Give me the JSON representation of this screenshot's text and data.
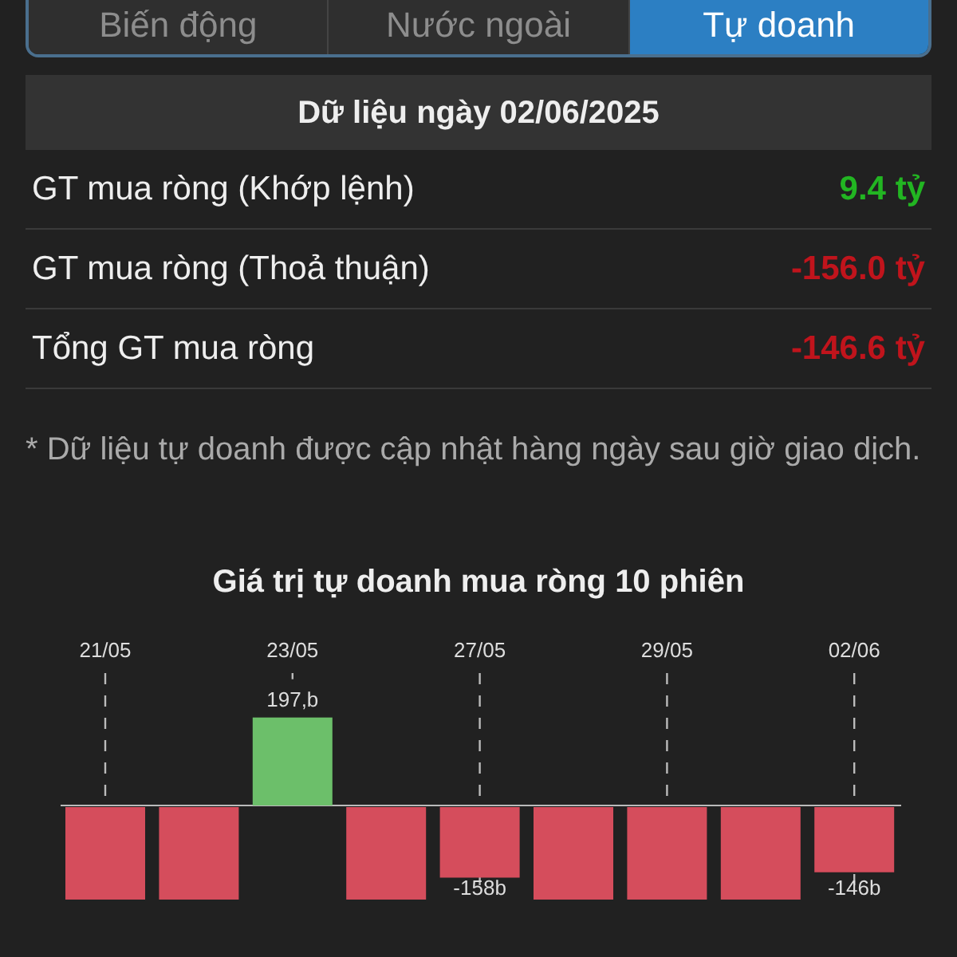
{
  "tabs": [
    {
      "label": "Biến động",
      "selected": false
    },
    {
      "label": "Nước ngoài",
      "selected": false
    },
    {
      "label": "Tự doanh",
      "selected": true
    }
  ],
  "header": "Dữ liệu ngày 02/06/2025",
  "rows": [
    {
      "label": "GT mua ròng (Khớp lệnh)",
      "value": "9.4 tỷ",
      "kind": "gain"
    },
    {
      "label": "GT mua ròng (Thoả thuận)",
      "value": "-156.0 tỷ",
      "kind": "loss"
    },
    {
      "label": "Tổng GT mua ròng",
      "value": "-146.6 tỷ",
      "kind": "loss"
    }
  ],
  "note": "* Dữ liệu tự doanh được cập nhật hàng ngày sau giờ giao dịch.",
  "chart": {
    "title": "Giá trị tự doanh mua ròng 10 phiên",
    "bars": [
      {
        "date": "21/05",
        "kind": "loss"
      },
      {
        "kind": "loss"
      },
      {
        "date": "23/05",
        "kind": "gain",
        "label": "197,b"
      },
      {
        "kind": "loss"
      },
      {
        "date": "27/05",
        "kind": "loss",
        "label": "-158b"
      },
      {
        "kind": "loss"
      },
      {
        "date": "29/05",
        "kind": "loss"
      },
      {
        "kind": "loss"
      },
      {
        "date": "02/06",
        "kind": "loss",
        "label": "-146b"
      }
    ]
  }
}
